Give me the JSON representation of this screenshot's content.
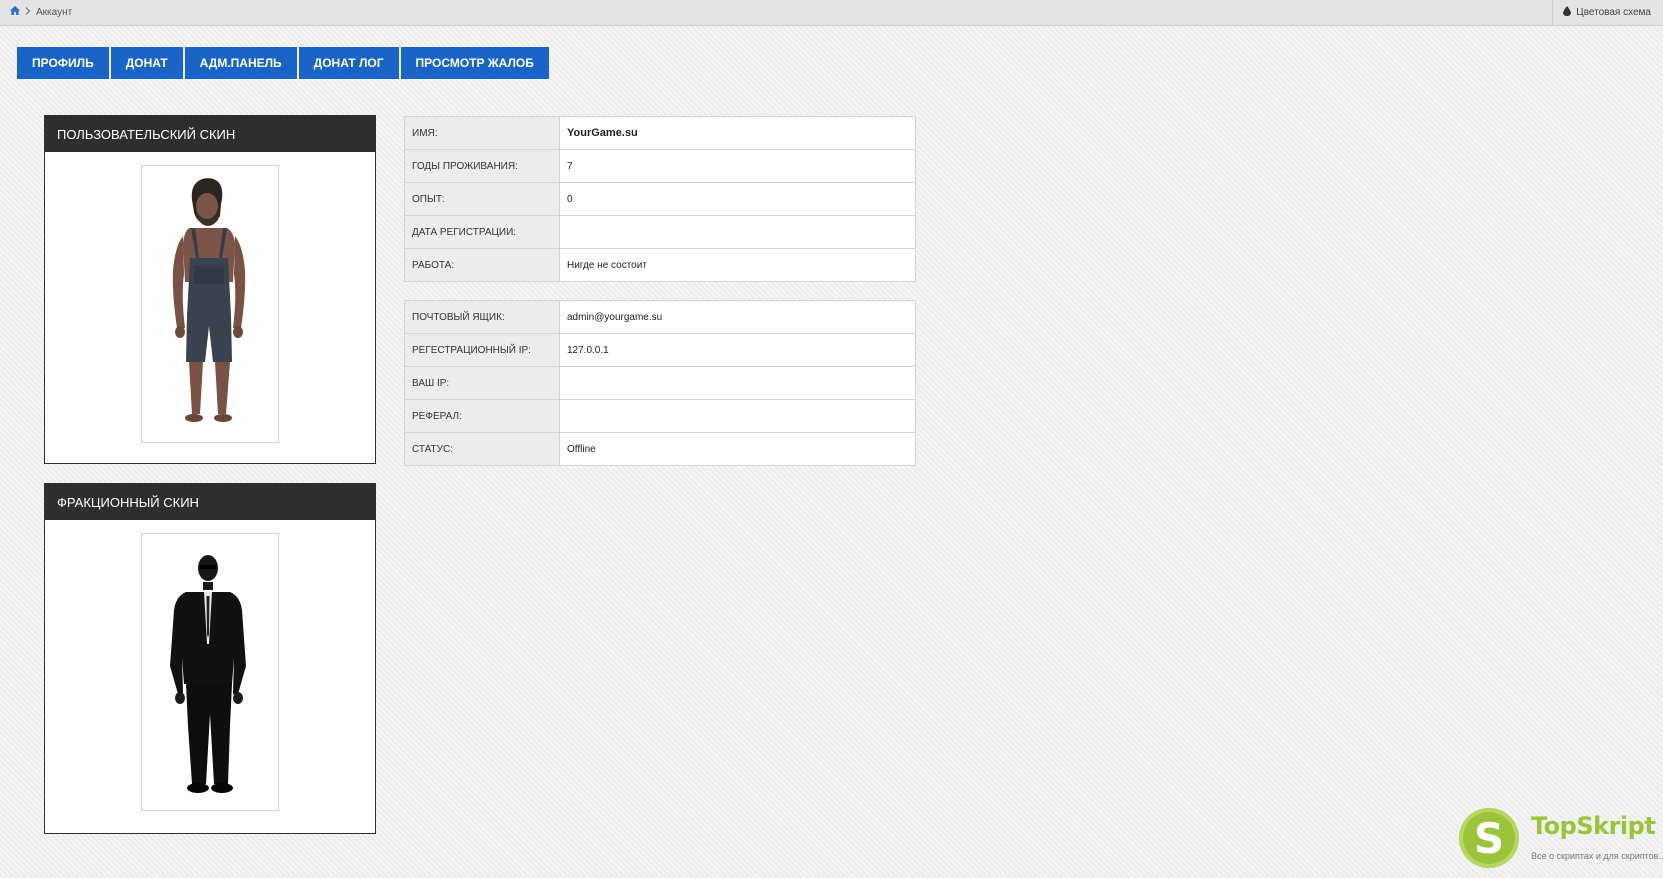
{
  "breadcrumb": {
    "current": "Аккаунт"
  },
  "header": {
    "color_scheme": "Цветовая схема"
  },
  "nav": [
    {
      "label": "ПРОФИЛЬ"
    },
    {
      "label": "ДОНАТ"
    },
    {
      "label": "АДМ.ПАНЕЛЬ"
    },
    {
      "label": "ДОНАТ ЛОГ"
    },
    {
      "label": "ПРОСМОТР ЖАЛОБ"
    }
  ],
  "skins": {
    "user_title": "ПОЛЬЗОВАТЕЛЬСКИЙ СКИН",
    "faction_title": "ФРАКЦИОННЫЙ СКИН"
  },
  "profile": [
    {
      "key": "ИМЯ:",
      "value": "YourGame.su"
    },
    {
      "key": "ГОДЫ ПРОЖИВАНИЯ:",
      "value": "7"
    },
    {
      "key": "ОПЫТ:",
      "value": "0"
    },
    {
      "key": "ДАТА РЕГИСТРАЦИИ:",
      "value": ""
    },
    {
      "key": "РАБОТА:",
      "value": "Нигде не состоит"
    }
  ],
  "account": [
    {
      "key": "ПОЧТОВЫЙ ЯЩИК:",
      "value": "admin@yourgame.su"
    },
    {
      "key": "РЕГЕСТРАЦИОННЫЙ IP:",
      "value": "127.0.0.1"
    },
    {
      "key": "ВАШ IP:",
      "value": ""
    },
    {
      "key": "РЕФЕРАЛ:",
      "value": ""
    },
    {
      "key": "СТАТУС:",
      "value": "Offline"
    }
  ],
  "watermark": {
    "letter": "S",
    "name": "TopSkript",
    "tagline": "Все о скриптах и для скриптов..."
  },
  "colors": {
    "accent": "#1a64c8",
    "header_dark": "#2e2e2e",
    "logo_green": "#9ac43a"
  },
  "icons": {
    "home": "home-icon",
    "chevron": "chevron-right-icon",
    "scheme": "droplet-icon"
  }
}
